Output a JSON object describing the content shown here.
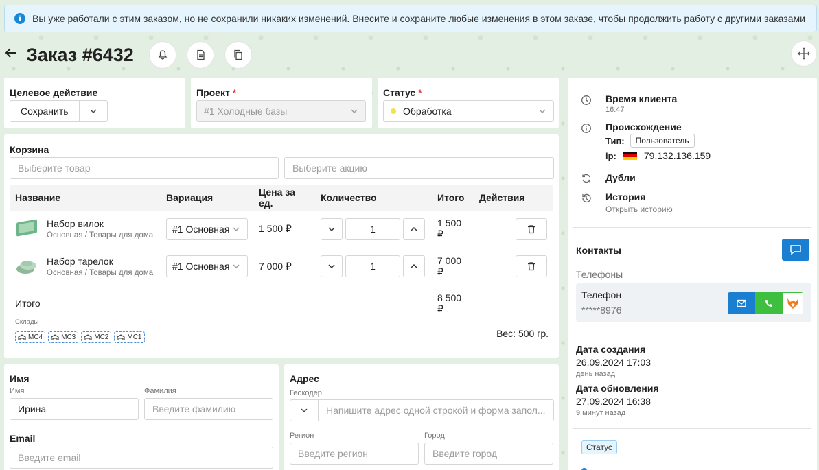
{
  "notice": {
    "text": "Вы уже работали с этим заказом, но не сохранили никаких изменений. Внесите и сохраните любые изменения в этом заказе, чтобы продолжить работу с другими заказами"
  },
  "header": {
    "title": "Заказ #6432"
  },
  "target_action": {
    "label": "Целевое действие",
    "button": "Сохранить"
  },
  "project": {
    "label": "Проект",
    "required": "*",
    "value": "#1 Холодные базы"
  },
  "status": {
    "label": "Статус",
    "required": "*",
    "value": "Обработка",
    "dot_color": "#f2e34b"
  },
  "cart": {
    "title": "Корзина",
    "product_placeholder": "Выберите товар",
    "promo_placeholder": "Выберите акцию",
    "columns": [
      "Название",
      "Вариация",
      "Цена за ед.",
      "Количество",
      "Итого",
      "Действия"
    ],
    "rows": [
      {
        "name": "Набор вилок",
        "category": "Основная / Товары для дома",
        "variation": "#1 Основная",
        "price": "1 500 ₽",
        "qty": "1",
        "total": "1 500 ₽"
      },
      {
        "name": "Набор тарелок",
        "category": "Основная / Товары для дома",
        "variation": "#1 Основная",
        "price": "7 000 ₽",
        "qty": "1",
        "total": "7 000 ₽"
      }
    ],
    "total_label": "Итого",
    "total_value": "8 500 ₽",
    "warehouses_label": "Склады",
    "warehouses": [
      "МС4",
      "МС3",
      "МС2",
      "МС1"
    ],
    "weight": "Вес: 500 гр."
  },
  "customer": {
    "name_title": "Имя",
    "first_name_label": "Имя",
    "first_name_value": "Ирина",
    "last_name_label": "Фамилия",
    "last_name_placeholder": "Введите фамилию",
    "email_title": "Email",
    "email_placeholder": "Введите email"
  },
  "address": {
    "title": "Адрес",
    "geocoder_label": "Геокодер",
    "geocoder_placeholder": "Напишите адрес одной строкой и форма запол...",
    "region_label": "Регион",
    "region_placeholder": "Введите регион",
    "city_label": "Город",
    "city_placeholder": "Введите город"
  },
  "sidebar": {
    "client_time_label": "Время клиента",
    "client_time_value": "16:47",
    "origin_label": "Происхождение",
    "type_label": "Тип:",
    "type_value": "Пользователь",
    "ip_label": "ip:",
    "ip_value": "79.132.136.159",
    "duplicates_label": "Дубли",
    "history_label": "История",
    "history_link": "Открыть историю",
    "contacts_title": "Контакты",
    "phones_label": "Телефоны",
    "phone_title": "Телефон",
    "phone_value": "*****8976",
    "created_label": "Дата создания",
    "created_value": "26.09.2024 17:03",
    "created_ago": "день назад",
    "updated_label": "Дата обновления",
    "updated_value": "27.09.2024 16:38",
    "updated_ago": "9 минут назад",
    "status_tag": "Статус"
  },
  "colors": {
    "accent_blue": "#1a7fd0",
    "call_green": "#3fbf3f",
    "notice_bg": "#e6f4fd"
  }
}
